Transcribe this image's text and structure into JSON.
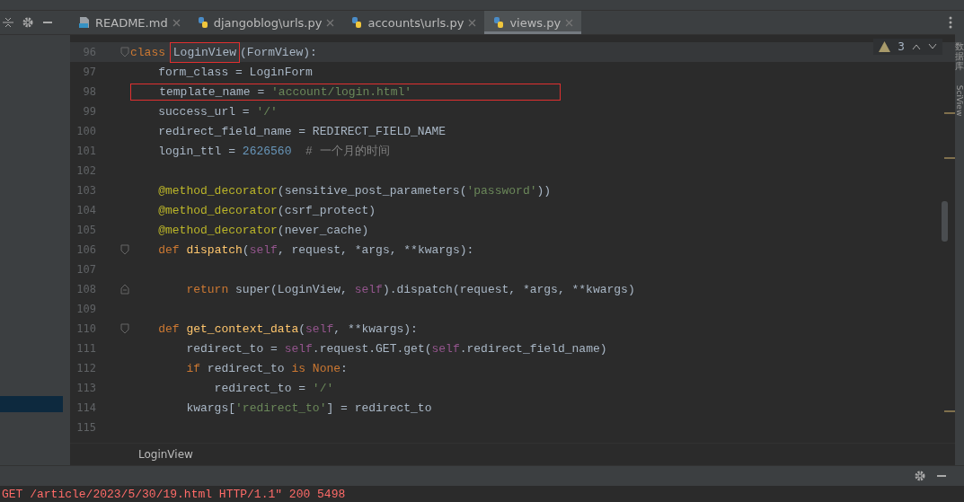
{
  "toolbar_tabs": [
    {
      "label": "README.md",
      "kind": "md",
      "selected": false
    },
    {
      "label": "djangoblog\\urls.py",
      "kind": "py",
      "selected": false
    },
    {
      "label": "accounts\\urls.py",
      "kind": "py",
      "selected": false
    },
    {
      "label": "views.py",
      "kind": "py",
      "selected": true
    }
  ],
  "inspection": {
    "count": "3"
  },
  "lines": [
    {
      "number": "96",
      "current": true,
      "fold_open": true,
      "fold_close": false,
      "boxed": false,
      "tokens": [
        {
          "t": "class ",
          "kind": "kw"
        },
        {
          "t": "LoginView",
          "kind": "plain",
          "boxed": true
        },
        {
          "t": "(FormView):",
          "kind": "plain"
        }
      ]
    },
    {
      "number": "97",
      "current": false,
      "fold_open": false,
      "fold_close": false,
      "boxed": false,
      "tokens": [
        {
          "t": "    form_class = LoginForm",
          "kind": "plain"
        }
      ]
    },
    {
      "number": "98",
      "current": false,
      "fold_open": false,
      "fold_close": false,
      "boxed": true,
      "tokens": [
        {
          "t": "    template_name = ",
          "kind": "plain"
        },
        {
          "t": "'account/login.html'",
          "kind": "str"
        }
      ]
    },
    {
      "number": "99",
      "current": false,
      "fold_open": false,
      "fold_close": false,
      "boxed": false,
      "tokens": [
        {
          "t": "    success_url = ",
          "kind": "plain"
        },
        {
          "t": "'/'",
          "kind": "str"
        }
      ]
    },
    {
      "number": "100",
      "current": false,
      "fold_open": false,
      "fold_close": false,
      "boxed": false,
      "tokens": [
        {
          "t": "    redirect_field_name = REDIRECT_FIELD_NAME",
          "kind": "plain"
        }
      ]
    },
    {
      "number": "101",
      "current": false,
      "fold_open": false,
      "fold_close": false,
      "boxed": false,
      "tokens": [
        {
          "t": "    login_ttl = ",
          "kind": "plain"
        },
        {
          "t": "2626560",
          "kind": "num"
        },
        {
          "t": "  # 一个月的时间",
          "kind": "comment"
        }
      ]
    },
    {
      "number": "102",
      "current": false,
      "fold_open": false,
      "fold_close": false,
      "boxed": false
    },
    {
      "number": "103",
      "current": false,
      "fold_open": false,
      "fold_close": false,
      "boxed": false,
      "tokens": [
        {
          "t": "    @method_decorator",
          "kind": "deco"
        },
        {
          "t": "(sensitive_post_parameters(",
          "kind": "plain"
        },
        {
          "t": "'password'",
          "kind": "str"
        },
        {
          "t": "))",
          "kind": "plain"
        }
      ]
    },
    {
      "number": "104",
      "current": false,
      "fold_open": false,
      "fold_close": false,
      "boxed": false,
      "tokens": [
        {
          "t": "    @method_decorator",
          "kind": "deco"
        },
        {
          "t": "(csrf_protect)",
          "kind": "plain"
        }
      ]
    },
    {
      "number": "105",
      "current": false,
      "fold_open": false,
      "fold_close": false,
      "boxed": false,
      "tokens": [
        {
          "t": "    @method_decorator",
          "kind": "deco"
        },
        {
          "t": "(never_cache)",
          "kind": "plain"
        }
      ]
    },
    {
      "number": "106",
      "current": false,
      "fold_open": true,
      "fold_close": false,
      "boxed": false,
      "tokens": [
        {
          "t": "    def ",
          "kind": "kw"
        },
        {
          "t": "dispatch",
          "kind": "fn"
        },
        {
          "t": "(",
          "kind": "plain"
        },
        {
          "t": "self",
          "kind": "self"
        },
        {
          "t": ", request, *args, **kwargs):",
          "kind": "plain"
        }
      ]
    },
    {
      "number": "107",
      "current": false,
      "fold_open": false,
      "fold_close": false,
      "boxed": false
    },
    {
      "number": "108",
      "current": false,
      "fold_open": false,
      "fold_close": true,
      "boxed": false,
      "tokens": [
        {
          "t": "        return ",
          "kind": "kw"
        },
        {
          "t": "super(LoginView, ",
          "kind": "plain"
        },
        {
          "t": "self",
          "kind": "self"
        },
        {
          "t": ").dispatch(request, *args, **kwargs)",
          "kind": "plain"
        }
      ]
    },
    {
      "number": "109",
      "current": false,
      "fold_open": false,
      "fold_close": false,
      "boxed": false
    },
    {
      "number": "110",
      "current": false,
      "fold_open": true,
      "fold_close": false,
      "boxed": false,
      "tokens": [
        {
          "t": "    def ",
          "kind": "kw"
        },
        {
          "t": "get_context_data",
          "kind": "fn"
        },
        {
          "t": "(",
          "kind": "plain"
        },
        {
          "t": "self",
          "kind": "self"
        },
        {
          "t": ", **kwargs):",
          "kind": "plain"
        }
      ]
    },
    {
      "number": "111",
      "current": false,
      "fold_open": false,
      "fold_close": false,
      "boxed": false,
      "tokens": [
        {
          "t": "        redirect_to = ",
          "kind": "plain"
        },
        {
          "t": "self",
          "kind": "self"
        },
        {
          "t": ".request.GET.get(",
          "kind": "plain"
        },
        {
          "t": "self",
          "kind": "self"
        },
        {
          "t": ".redirect_field_name)",
          "kind": "plain"
        }
      ]
    },
    {
      "number": "112",
      "current": false,
      "fold_open": false,
      "fold_close": false,
      "boxed": false,
      "tokens": [
        {
          "t": "        if ",
          "kind": "kw"
        },
        {
          "t": "redirect_to ",
          "kind": "plain"
        },
        {
          "t": "is None",
          "kind": "kw"
        },
        {
          "t": ":",
          "kind": "plain"
        }
      ]
    },
    {
      "number": "113",
      "current": false,
      "fold_open": false,
      "fold_close": false,
      "boxed": false,
      "tokens": [
        {
          "t": "            redirect_to = ",
          "kind": "plain"
        },
        {
          "t": "'/'",
          "kind": "str"
        }
      ]
    },
    {
      "number": "114",
      "current": false,
      "fold_open": false,
      "fold_close": false,
      "boxed": false,
      "tokens": [
        {
          "t": "        kwargs[",
          "kind": "plain"
        },
        {
          "t": "'redirect_to'",
          "kind": "str"
        },
        {
          "t": "] = redirect_to",
          "kind": "plain"
        }
      ]
    },
    {
      "number": "115",
      "current": false,
      "fold_open": false,
      "fold_close": false,
      "boxed": false
    }
  ],
  "breadcrumb": "LoginView",
  "side_labels": [
    {
      "label": "数据库",
      "kind": "cjk"
    },
    {
      "label": "SciView",
      "kind": "latin"
    }
  ],
  "log_line": "GET /article/2023/5/30/19.html HTTP/1.1\" 200 5498"
}
